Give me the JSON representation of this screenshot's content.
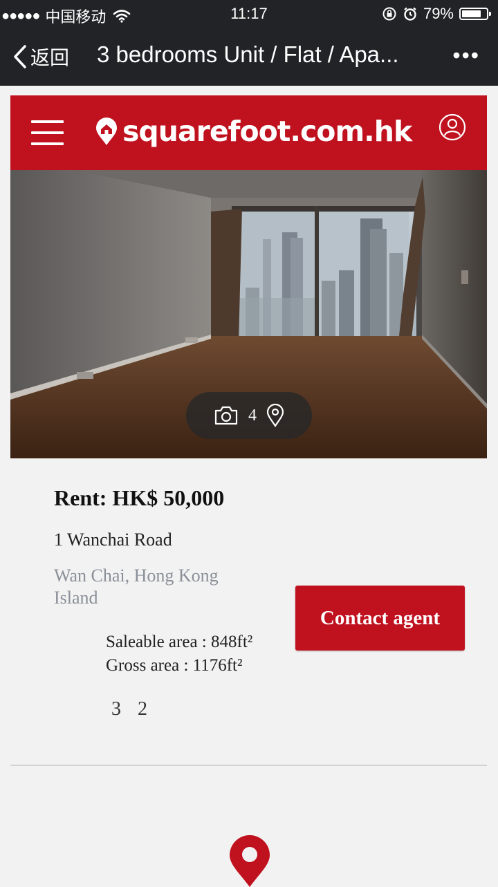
{
  "status_bar": {
    "signal_dots": "●●●●●",
    "carrier": "中国移动",
    "time": "11:17",
    "battery": "79%",
    "battery_level": 0.79
  },
  "nav": {
    "back_label": "返回",
    "title": "3 bedrooms Unit / Flat / Apa...",
    "more": "•••"
  },
  "site": {
    "brand": "squarefoot.com.hk",
    "brand_color": "#c0111f"
  },
  "gallery": {
    "photo_count": "4"
  },
  "listing": {
    "price": "Rent: HK$ 50,000",
    "address": "1 Wanchai Road",
    "district": "Wan Chai, Hong Kong Island",
    "saleable_area": "Saleable area : 848ft²",
    "gross_area": "Gross area : 1176ft²",
    "bedrooms": "3",
    "bathrooms": "2"
  },
  "actions": {
    "contact_label": "Contact agent"
  },
  "icons": [
    "back-chevron-icon",
    "wifi-icon",
    "lock-rotation-icon",
    "alarm-icon",
    "battery-icon",
    "menu-icon",
    "logo-house-pin-icon",
    "user-icon",
    "camera-icon",
    "location-pin-icon",
    "map-pin-icon"
  ]
}
